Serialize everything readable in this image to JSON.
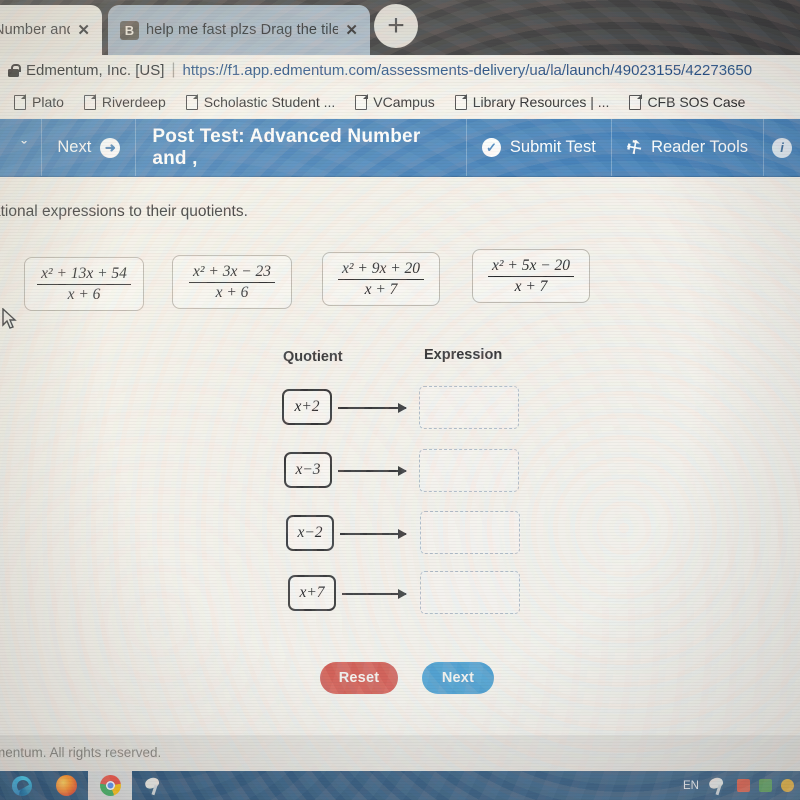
{
  "browser": {
    "tabs": [
      {
        "title": "Number and",
        "close_label": "✕",
        "favicon": "none",
        "active": false
      },
      {
        "title": "help me fast plzs Drag the tiles t",
        "close_label": "✕",
        "favicon": "B",
        "active": true
      }
    ],
    "new_tab_label": "+",
    "address": {
      "security_icon": "lock-icon",
      "site_identity": "Edmentum, Inc. [US]",
      "separator": "|",
      "url": "https://f1.app.edmentum.com/assessments-delivery/ua/la/launch/49023155/42273650"
    },
    "bookmarks": [
      {
        "label": "Plato"
      },
      {
        "label": "Riverdeep"
      },
      {
        "label": "Scholastic Student ..."
      },
      {
        "label": "VCampus"
      },
      {
        "label": "Library Resources | ..."
      },
      {
        "label": "CFB SOS Case"
      }
    ]
  },
  "app_toolbar": {
    "menu_chevron": "ˇ",
    "next_label": "Next",
    "next_icon": "➜",
    "title": "Post Test: Advanced Number and ,",
    "submit_label": "Submit Test",
    "submit_icon": "✓",
    "reader_tools_label": "Reader Tools",
    "reader_tools_icon": "⚒",
    "info_icon": "i",
    "background_color": "#3b7ab5"
  },
  "question": {
    "instruction": "ational expressions to their quotients.",
    "expression_tiles": [
      {
        "numerator": "x² + 13x + 54",
        "denominator": "x + 6"
      },
      {
        "numerator": "x² + 3x − 23",
        "denominator": "x + 6"
      },
      {
        "numerator": "x² + 9x + 20",
        "denominator": "x + 7"
      },
      {
        "numerator": "x² + 5x − 20",
        "denominator": "x + 7"
      }
    ],
    "column_headers": {
      "quotient": "Quotient",
      "expression": "Expression"
    },
    "match_rows": [
      {
        "quotient": "x+2",
        "dropzone_value": ""
      },
      {
        "quotient": "x−3",
        "dropzone_value": ""
      },
      {
        "quotient": "x−2",
        "dropzone_value": ""
      },
      {
        "quotient": "x+7",
        "dropzone_value": ""
      }
    ],
    "buttons": {
      "reset_label": "Reset",
      "reset_color": "#cf5147",
      "next_label": "Next",
      "next_color": "#3d96cb"
    }
  },
  "footer": {
    "copyright": "mentum. All rights reserved."
  },
  "taskbar": {
    "apps": [
      {
        "name": "edge"
      },
      {
        "name": "firefox"
      },
      {
        "name": "chrome",
        "active": true
      },
      {
        "name": "satellite"
      }
    ],
    "tray": {
      "language": "EN"
    }
  }
}
